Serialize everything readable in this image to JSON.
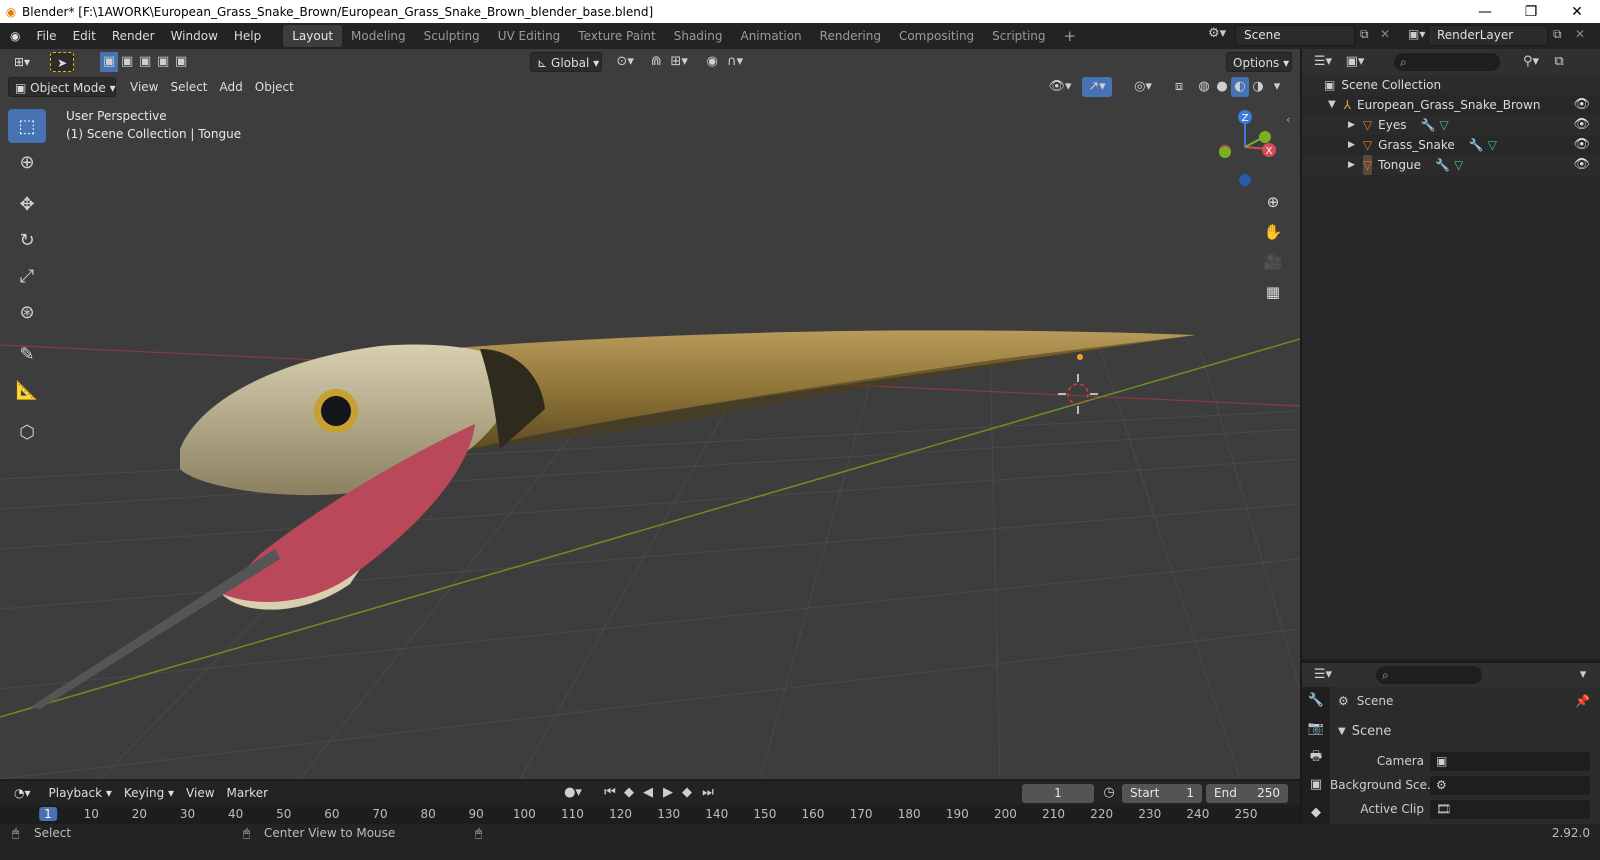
{
  "window": {
    "title": "Blender* [F:\\1AWORK\\European_Grass_Snake_Brown/European_Grass_Snake_Brown_blender_base.blend]",
    "minimize": "—",
    "maximize": "❐",
    "close": "✕"
  },
  "menu": [
    "File",
    "Edit",
    "Render",
    "Window",
    "Help"
  ],
  "workspaces": [
    "Layout",
    "Modeling",
    "Sculpting",
    "UV Editing",
    "Texture Paint",
    "Shading",
    "Animation",
    "Rendering",
    "Compositing",
    "Scripting"
  ],
  "active_workspace": "Layout",
  "scene_name": "Scene",
  "view_layer": "RenderLayer",
  "viewport": {
    "transform_orientation": "Global",
    "options_label": "Options",
    "mode": "Object Mode",
    "menus": [
      "View",
      "Select",
      "Add",
      "Object"
    ],
    "overlay_line1": "User Perspective",
    "overlay_line2": "(1) Scene Collection | Tongue",
    "gizmo_axes": {
      "x": "X",
      "y": "Y",
      "z": "Z"
    }
  },
  "outliner": {
    "root": "Scene Collection",
    "items": [
      {
        "name": "European_Grass_Snake_Brown",
        "type": "armature-icon"
      },
      {
        "name": "Eyes",
        "type": "mesh-icon"
      },
      {
        "name": "Grass_Snake",
        "type": "mesh-icon"
      },
      {
        "name": "Tongue",
        "type": "mesh-icon"
      }
    ]
  },
  "properties": {
    "context": "Scene",
    "panel": "Scene",
    "fields": [
      {
        "label": "Camera",
        "value": ""
      },
      {
        "label": "Background Sce...",
        "value": ""
      },
      {
        "label": "Active Clip",
        "value": ""
      }
    ]
  },
  "timeline": {
    "menus": [
      "Playback",
      "Keying",
      "View",
      "Marker"
    ],
    "current_frame": "1",
    "start_label": "Start",
    "start": "1",
    "end_label": "End",
    "end": "250",
    "ruler": [
      "1",
      "10",
      "20",
      "30",
      "40",
      "50",
      "60",
      "70",
      "80",
      "90",
      "100",
      "110",
      "120",
      "130",
      "140",
      "150",
      "160",
      "170",
      "180",
      "190",
      "200",
      "210",
      "220",
      "230",
      "240",
      "250"
    ]
  },
  "status": {
    "select": "Select",
    "center": "Center View to Mouse",
    "version": "2.92.0"
  },
  "colors": {
    "accent": "#4772b3",
    "viewport_bg": "#3d3d3d",
    "x_axis": "#d94b56",
    "y_axis": "#7bb026",
    "z_axis": "#3c7bdc"
  }
}
